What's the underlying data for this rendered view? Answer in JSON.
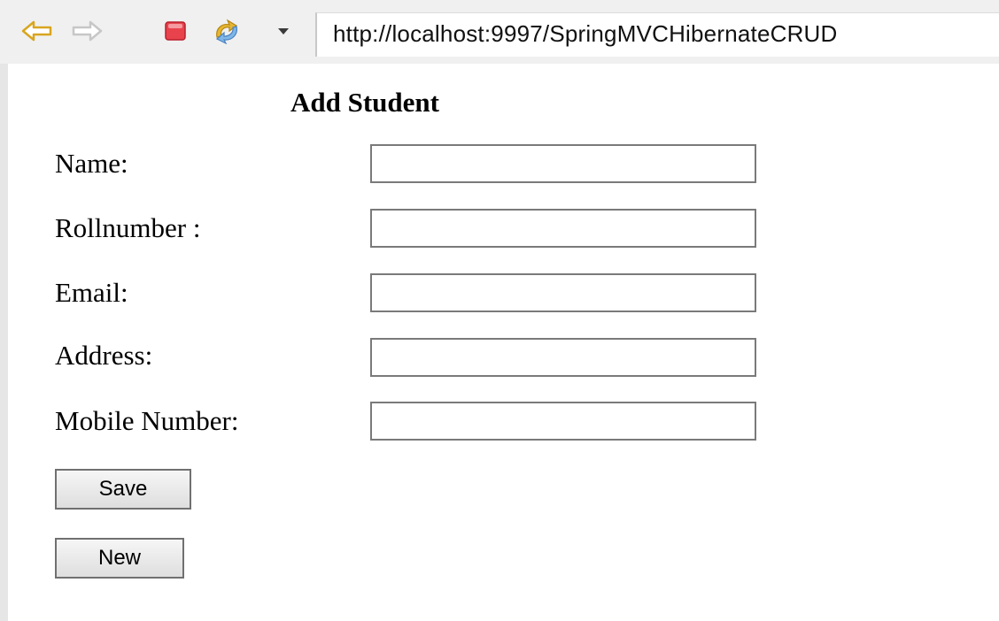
{
  "browser": {
    "url": "http://localhost:9997/SpringMVCHibernateCRUD",
    "icons": {
      "back": "arrow-left-icon",
      "forward": "arrow-right-icon",
      "stop": "stop-icon",
      "refresh": "refresh-icon",
      "dropdown": "chevron-down-icon"
    }
  },
  "form": {
    "title": "Add Student",
    "fields": [
      {
        "label": "Name:",
        "value": ""
      },
      {
        "label": "Rollnumber :",
        "value": ""
      },
      {
        "label": "Email:",
        "value": ""
      },
      {
        "label": "Address:",
        "value": ""
      },
      {
        "label": "Mobile Number:",
        "value": ""
      }
    ],
    "save_label": "Save",
    "new_label": "New"
  }
}
